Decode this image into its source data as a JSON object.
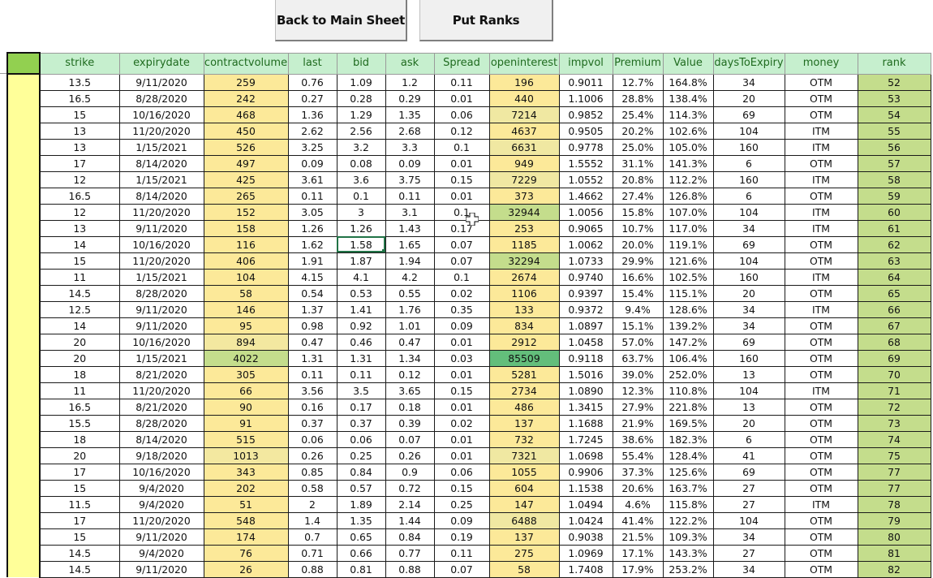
{
  "toolbar": {
    "back_label": "Back to Main Sheet",
    "ranks_label": "Put Ranks"
  },
  "colors": {
    "header_bg": "#c6efce",
    "header_text": "#1f6b1f",
    "corner_bg": "#92d050",
    "sidebar_bg": "#ffff99",
    "scale_low": "#fce999",
    "scale_mid": "#c4dd8c",
    "scale_high": "#63be7b",
    "rank_bg": "#c4dd8c",
    "selection": "#217346"
  },
  "selected_cell": {
    "row": 10,
    "column": "bid"
  },
  "columns": [
    "strike",
    "expirydate",
    "contractvolume",
    "last",
    "bid",
    "ask",
    "Spread",
    "openinterest",
    "impvol",
    "Premium",
    "Value",
    "daysToExpiry",
    "money",
    "rank"
  ],
  "rows": [
    [
      "13.5",
      "9/11/2020",
      "259",
      "0.76",
      "1.09",
      "1.2",
      "0.11",
      "196",
      "0.9011",
      "12.7%",
      "164.8%",
      "34",
      "OTM",
      "52"
    ],
    [
      "16.5",
      "8/28/2020",
      "242",
      "0.27",
      "0.28",
      "0.29",
      "0.01",
      "440",
      "1.1006",
      "28.8%",
      "138.4%",
      "20",
      "OTM",
      "53"
    ],
    [
      "15",
      "10/16/2020",
      "468",
      "1.36",
      "1.29",
      "1.35",
      "0.06",
      "7214",
      "0.9852",
      "25.4%",
      "114.3%",
      "69",
      "OTM",
      "54"
    ],
    [
      "13",
      "11/20/2020",
      "450",
      "2.62",
      "2.56",
      "2.68",
      "0.12",
      "4637",
      "0.9505",
      "20.2%",
      "102.6%",
      "104",
      "ITM",
      "55"
    ],
    [
      "13",
      "1/15/2021",
      "526",
      "3.25",
      "3.2",
      "3.3",
      "0.1",
      "6631",
      "0.9778",
      "25.0%",
      "105.0%",
      "160",
      "ITM",
      "56"
    ],
    [
      "17",
      "8/14/2020",
      "497",
      "0.09",
      "0.08",
      "0.09",
      "0.01",
      "949",
      "1.5552",
      "31.1%",
      "141.3%",
      "6",
      "OTM",
      "57"
    ],
    [
      "12",
      "1/15/2021",
      "425",
      "3.61",
      "3.6",
      "3.75",
      "0.15",
      "7229",
      "1.0552",
      "20.8%",
      "112.2%",
      "160",
      "ITM",
      "58"
    ],
    [
      "16.5",
      "8/14/2020",
      "265",
      "0.11",
      "0.1",
      "0.11",
      "0.01",
      "373",
      "1.4662",
      "27.4%",
      "126.8%",
      "6",
      "OTM",
      "59"
    ],
    [
      "12",
      "11/20/2020",
      "152",
      "3.05",
      "3",
      "3.1",
      "0.1",
      "32944",
      "1.0056",
      "15.8%",
      "107.0%",
      "104",
      "ITM",
      "60"
    ],
    [
      "13",
      "9/11/2020",
      "158",
      "1.26",
      "1.26",
      "1.43",
      "0.17",
      "253",
      "0.9065",
      "10.7%",
      "117.0%",
      "34",
      "ITM",
      "61"
    ],
    [
      "14",
      "10/16/2020",
      "116",
      "1.62",
      "1.58",
      "1.65",
      "0.07",
      "1185",
      "1.0062",
      "20.0%",
      "119.1%",
      "69",
      "OTM",
      "62"
    ],
    [
      "15",
      "11/20/2020",
      "406",
      "1.91",
      "1.87",
      "1.94",
      "0.07",
      "32294",
      "1.0733",
      "29.9%",
      "121.6%",
      "104",
      "OTM",
      "63"
    ],
    [
      "11",
      "1/15/2021",
      "104",
      "4.15",
      "4.1",
      "4.2",
      "0.1",
      "2674",
      "0.9740",
      "16.6%",
      "102.5%",
      "160",
      "ITM",
      "64"
    ],
    [
      "14.5",
      "8/28/2020",
      "58",
      "0.54",
      "0.53",
      "0.55",
      "0.02",
      "1106",
      "0.9397",
      "15.4%",
      "115.1%",
      "20",
      "OTM",
      "65"
    ],
    [
      "12.5",
      "9/11/2020",
      "146",
      "1.37",
      "1.41",
      "1.76",
      "0.35",
      "133",
      "0.9372",
      "9.4%",
      "128.6%",
      "34",
      "ITM",
      "66"
    ],
    [
      "14",
      "9/11/2020",
      "95",
      "0.98",
      "0.92",
      "1.01",
      "0.09",
      "834",
      "1.0897",
      "15.1%",
      "139.2%",
      "34",
      "OTM",
      "67"
    ],
    [
      "20",
      "10/16/2020",
      "894",
      "0.47",
      "0.46",
      "0.47",
      "0.01",
      "2912",
      "1.0458",
      "57.0%",
      "147.2%",
      "69",
      "OTM",
      "68"
    ],
    [
      "20",
      "1/15/2021",
      "4022",
      "1.31",
      "1.31",
      "1.34",
      "0.03",
      "85509",
      "0.9118",
      "63.7%",
      "106.4%",
      "160",
      "OTM",
      "69"
    ],
    [
      "18",
      "8/21/2020",
      "305",
      "0.11",
      "0.11",
      "0.12",
      "0.01",
      "5281",
      "1.5016",
      "39.0%",
      "252.0%",
      "13",
      "OTM",
      "70"
    ],
    [
      "11",
      "11/20/2020",
      "66",
      "3.56",
      "3.5",
      "3.65",
      "0.15",
      "2734",
      "1.0890",
      "12.3%",
      "110.8%",
      "104",
      "ITM",
      "71"
    ],
    [
      "16.5",
      "8/21/2020",
      "90",
      "0.16",
      "0.17",
      "0.18",
      "0.01",
      "486",
      "1.3415",
      "27.9%",
      "221.8%",
      "13",
      "OTM",
      "72"
    ],
    [
      "15.5",
      "8/28/2020",
      "91",
      "0.37",
      "0.37",
      "0.39",
      "0.02",
      "137",
      "1.1688",
      "21.9%",
      "169.5%",
      "20",
      "OTM",
      "73"
    ],
    [
      "18",
      "8/14/2020",
      "515",
      "0.06",
      "0.06",
      "0.07",
      "0.01",
      "732",
      "1.7245",
      "38.6%",
      "182.3%",
      "6",
      "OTM",
      "74"
    ],
    [
      "20",
      "9/18/2020",
      "1013",
      "0.26",
      "0.25",
      "0.26",
      "0.01",
      "7321",
      "1.0698",
      "55.4%",
      "128.4%",
      "41",
      "OTM",
      "75"
    ],
    [
      "17",
      "10/16/2020",
      "343",
      "0.85",
      "0.84",
      "0.9",
      "0.06",
      "1055",
      "0.9906",
      "37.3%",
      "125.6%",
      "69",
      "OTM",
      "77"
    ],
    [
      "15",
      "9/4/2020",
      "202",
      "0.58",
      "0.57",
      "0.72",
      "0.15",
      "604",
      "1.1538",
      "20.6%",
      "163.7%",
      "27",
      "OTM",
      "77"
    ],
    [
      "11.5",
      "9/4/2020",
      "51",
      "2",
      "1.89",
      "2.14",
      "0.25",
      "147",
      "1.0494",
      "4.6%",
      "115.8%",
      "27",
      "ITM",
      "78"
    ],
    [
      "17",
      "11/20/2020",
      "548",
      "1.4",
      "1.35",
      "1.44",
      "0.09",
      "6488",
      "1.0424",
      "41.4%",
      "122.2%",
      "104",
      "OTM",
      "79"
    ],
    [
      "15",
      "9/11/2020",
      "174",
      "0.7",
      "0.65",
      "0.84",
      "0.19",
      "137",
      "0.9038",
      "21.5%",
      "109.3%",
      "34",
      "OTM",
      "80"
    ],
    [
      "14.5",
      "9/4/2020",
      "76",
      "0.71",
      "0.66",
      "0.77",
      "0.11",
      "275",
      "1.0969",
      "17.1%",
      "143.3%",
      "27",
      "OTM",
      "81"
    ],
    [
      "14.5",
      "9/11/2020",
      "26",
      "0.88",
      "0.81",
      "0.88",
      "0.07",
      "58",
      "1.7408",
      "17.9%",
      "253.2%",
      "34",
      "OTM",
      "82"
    ]
  ]
}
